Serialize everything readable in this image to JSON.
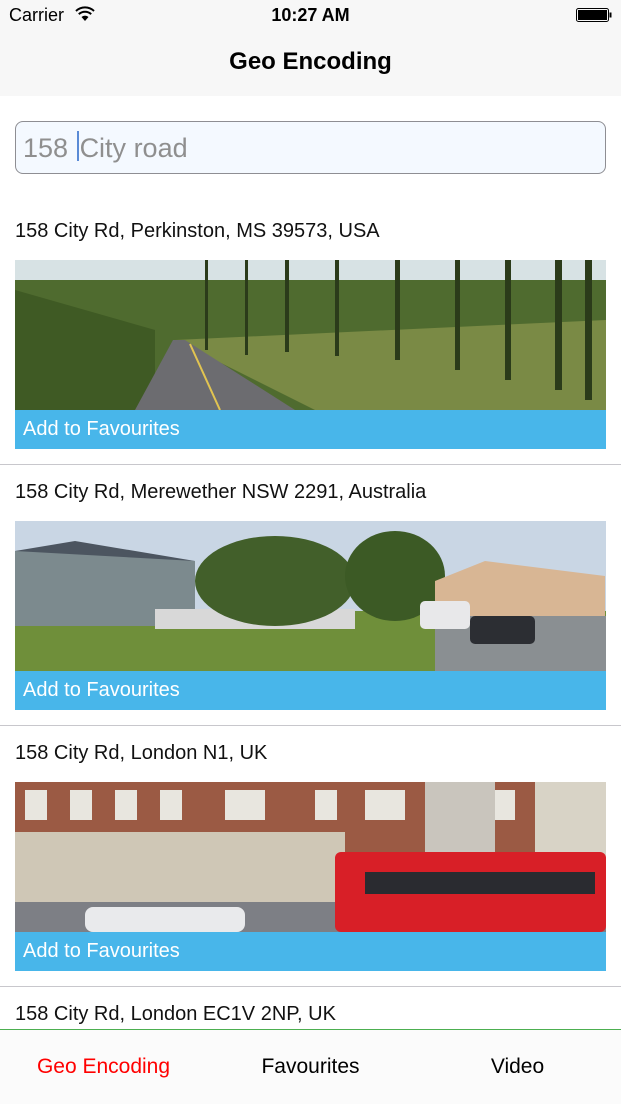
{
  "status_bar": {
    "carrier": "Carrier",
    "time": "10:27 AM"
  },
  "nav": {
    "title": "Geo Encoding"
  },
  "search": {
    "text_before_caret": "158 ",
    "text_after_caret": "City road"
  },
  "results": [
    {
      "address": "158 City Rd, Perkinston, MS 39573, USA",
      "button": "Add to Favourites"
    },
    {
      "address": "158 City Rd, Merewether NSW 2291, Australia",
      "button": "Add to Favourites"
    },
    {
      "address": "158 City Rd, London N1, UK",
      "button": "Add to Favourites"
    },
    {
      "address": "158 City Rd, London EC1V 2NP, UK"
    }
  ],
  "tabs": [
    {
      "label": "Geo Encoding",
      "active": true
    },
    {
      "label": "Favourites",
      "active": false
    },
    {
      "label": "Video",
      "active": false
    }
  ],
  "colors": {
    "accent_button": "#48b6ea",
    "active_tab": "#ff0000",
    "tabbar_border": "#4caf50"
  }
}
